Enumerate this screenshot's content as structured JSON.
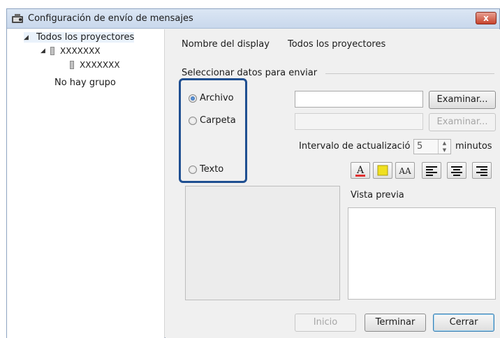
{
  "window": {
    "title": "Configuración de envío de mensajes",
    "close_label": "x"
  },
  "tree": {
    "root": "Todos los proyectores",
    "child": "XXXXXXX",
    "grandchild": "XXXXXXX",
    "no_group": "No hay grupo"
  },
  "header": {
    "display_name_label": "Nombre del display",
    "display_name_value": "Todos los proyectores"
  },
  "section": {
    "select_data_label": "Seleccionar datos para enviar"
  },
  "options": {
    "file_label": "Archivo",
    "folder_label": "Carpeta",
    "text_label": "Texto",
    "selected": "Archivo"
  },
  "inputs": {
    "file_path_value": "",
    "folder_path_value": "",
    "browse_file_label": "Examinar...",
    "browse_folder_label": "Examinar..."
  },
  "interval": {
    "label": "Intervalo de actualizació",
    "value": "5",
    "unit": "minutos"
  },
  "format_toolbar": {
    "text_color_glyph": "A",
    "font_size_glyph": "AA"
  },
  "preview": {
    "label": "Vista previa"
  },
  "buttons": {
    "start_label": "Inicio",
    "finish_label": "Terminar",
    "close_label": "Cerrar"
  },
  "colors": {
    "highlight_border": "#1f4f91",
    "text_color_underline": "#e03030",
    "background_swatch": "#f0e020"
  }
}
